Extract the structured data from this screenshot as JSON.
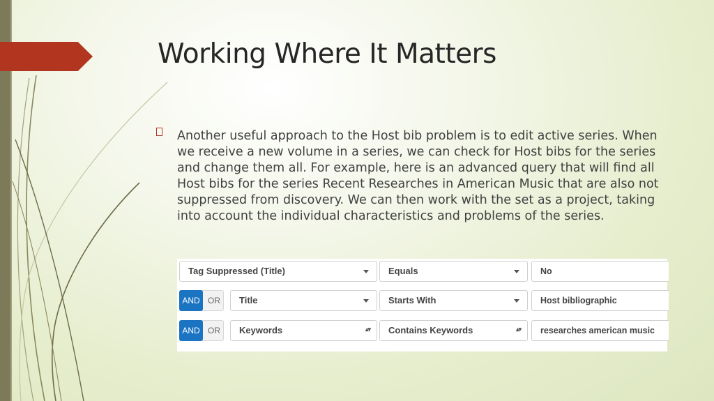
{
  "slide": {
    "title": "Working Where It Matters",
    "bullet_text": "Another useful approach to the Host bib problem is to edit active series.  When we receive a new volume in a series, we can check for Host bibs for the series and change them all.  For example, here is an advanced query that will find all Host bibs for the series Recent Researches in American Music that are also not suppressed from discovery.  We can then work with the set as a project, taking into account the individual characteristics and problems of the series."
  },
  "query": {
    "rows": [
      {
        "field": "Tag Suppressed (Title)",
        "operator": "Equals",
        "value": "No"
      },
      {
        "and_label": "AND",
        "or_label": "OR",
        "field": "Title",
        "operator": "Starts With",
        "value": "Host bibliographic"
      },
      {
        "and_label": "AND",
        "or_label": "OR",
        "field": "Keywords",
        "operator": "Contains Keywords",
        "value": "researches american music"
      }
    ]
  },
  "colors": {
    "accent": "#b23520",
    "sidebar": "#7d7a5a",
    "and_button": "#1a74c2"
  }
}
